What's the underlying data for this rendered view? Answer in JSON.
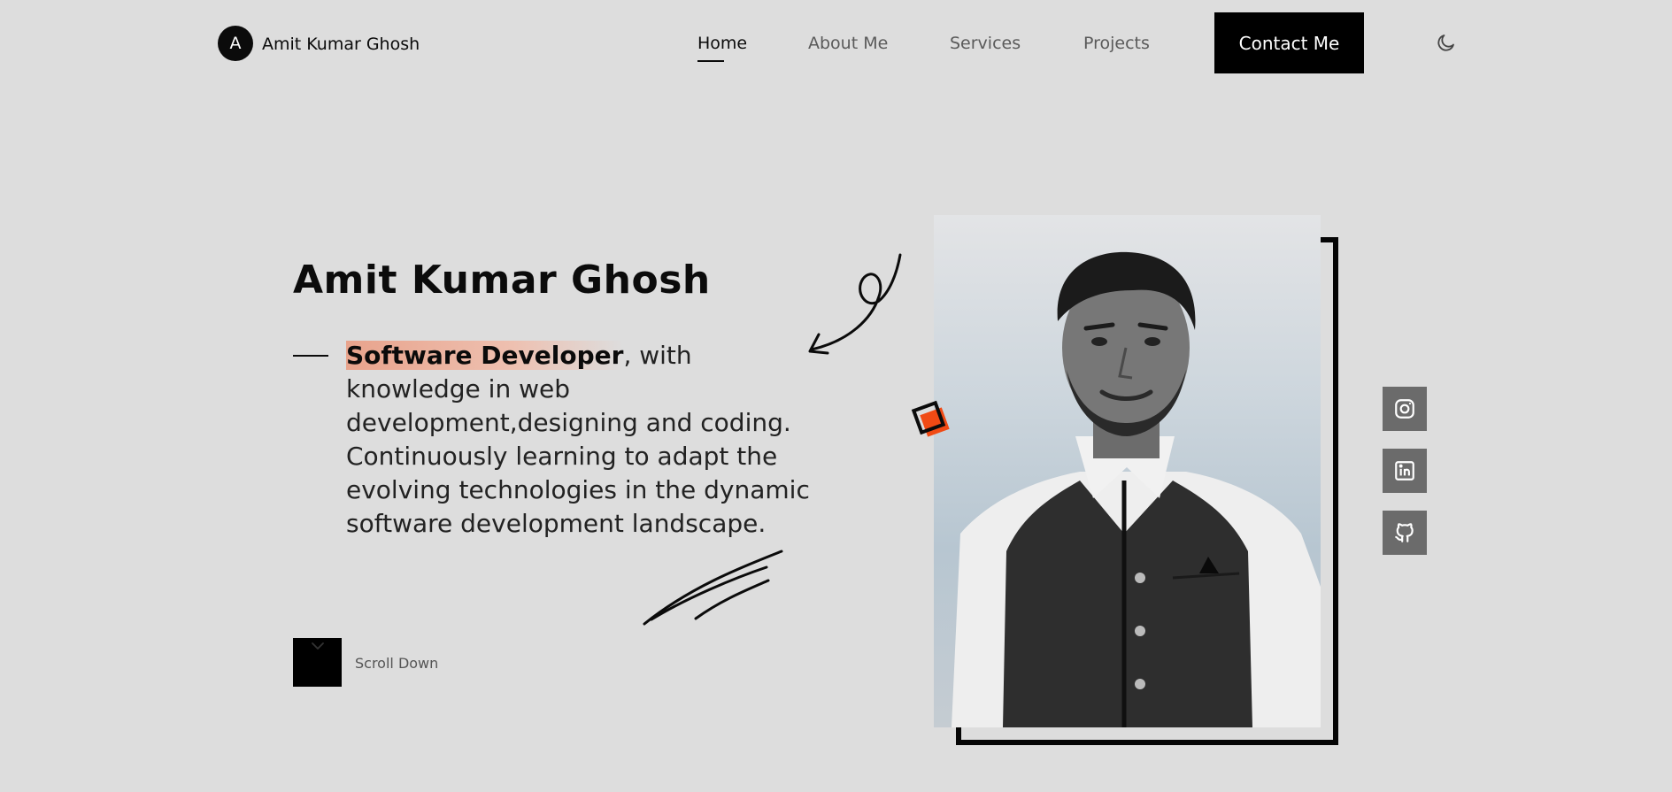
{
  "nav": {
    "logo_letter": "A",
    "brand_name": "Amit Kumar Ghosh",
    "links": [
      {
        "label": "Home",
        "active": true
      },
      {
        "label": "About Me",
        "active": false
      },
      {
        "label": "Services",
        "active": false
      },
      {
        "label": "Projects",
        "active": false
      }
    ],
    "contact_label": "Contact Me",
    "theme_icon": "moon-icon"
  },
  "hero": {
    "title": "Amit Kumar Ghosh",
    "role_highlight": "Software Developer",
    "description": ", with knowledge in web development,designing and coding. Continuously learning to adapt the evolving technologies in the dynamic software development landscape.",
    "scroll_label": "Scroll Down",
    "scroll_icon": "chevron-down-icon"
  },
  "photo": {
    "decor_icon": "square-accent-icon"
  },
  "social": [
    {
      "name": "instagram-icon"
    },
    {
      "name": "linkedin-icon"
    },
    {
      "name": "github-icon"
    }
  ],
  "colors": {
    "background": "#dddddd",
    "text": "#0b0b0b",
    "highlight": "#e8a38c",
    "accent": "#f04a14",
    "social_bg": "#6b6b6b"
  }
}
